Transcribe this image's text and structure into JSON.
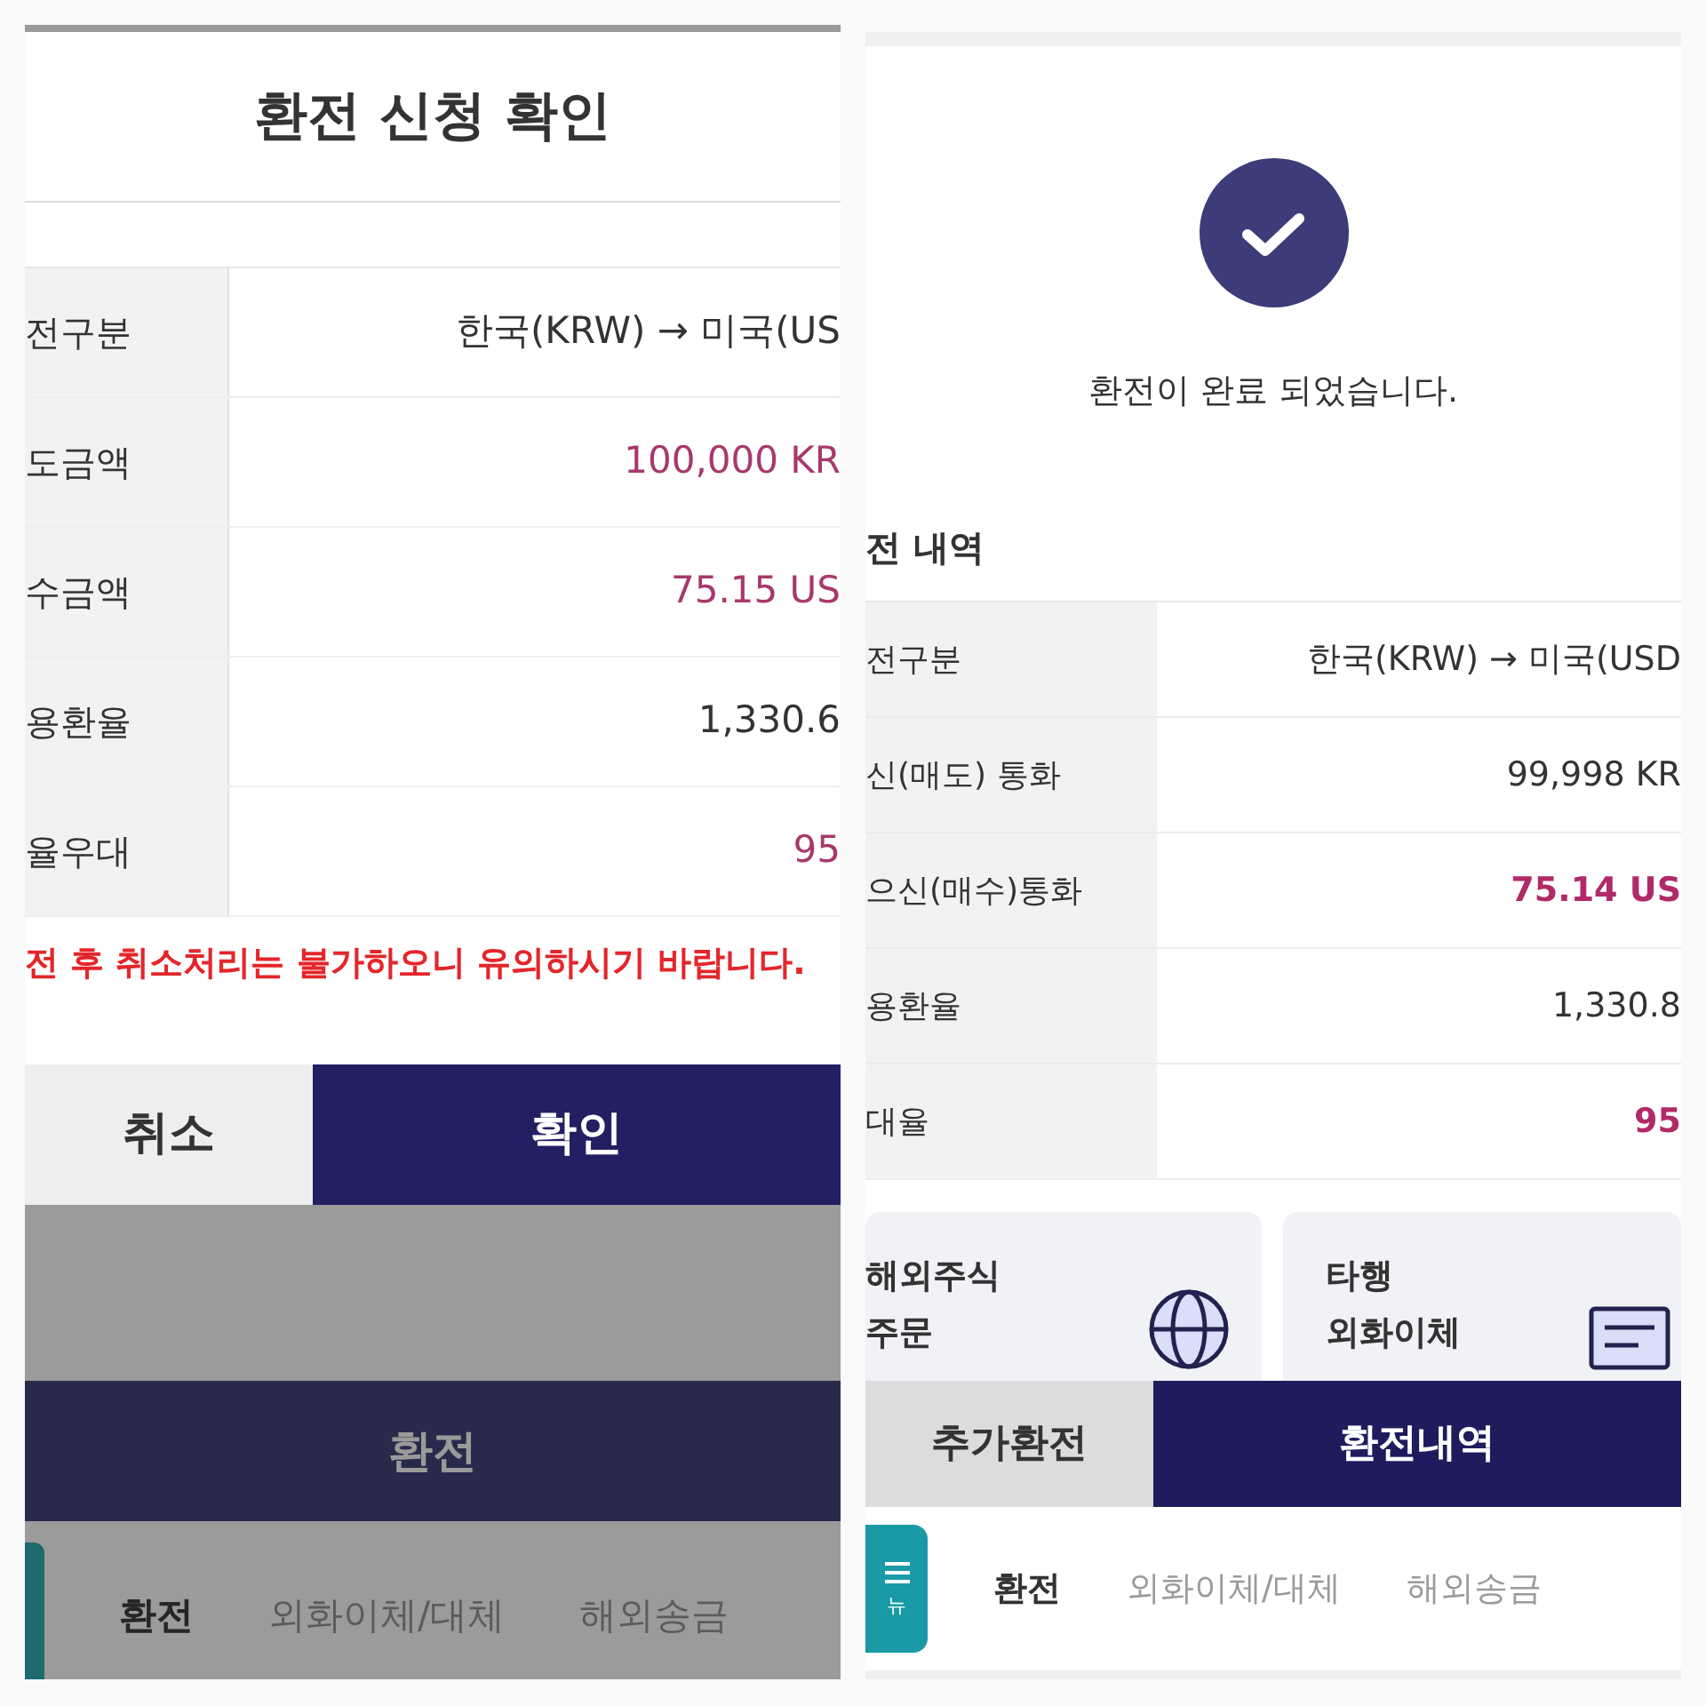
{
  "confirm_screen": {
    "title": "환전 신청 확인",
    "details": [
      {
        "label": "전구분",
        "value": "한국(KRW) → 미국(US",
        "highlight": false
      },
      {
        "label": "도금액",
        "value": "100,000 KR",
        "highlight": true
      },
      {
        "label": "수금액",
        "value": "75.15 US",
        "highlight": true
      },
      {
        "label": "용환율",
        "value": "1,330.6",
        "highlight": false
      },
      {
        "label": "율우대",
        "value": "95",
        "highlight": true
      }
    ],
    "warning": "전 후 취소처리는 불가하오니 유의하시기 바랍니다.",
    "buttons": [
      {
        "label": "취소",
        "kind": "secondary"
      },
      {
        "label": "확인",
        "kind": "primary"
      }
    ],
    "page_behind": {
      "title": "환전",
      "tabs": [
        {
          "label": "환전",
          "selected": true
        },
        {
          "label": "외화이체/대체",
          "selected": false
        },
        {
          "label": "해외송금",
          "selected": false
        }
      ]
    }
  },
  "complete_screen": {
    "message": "환전이 완료 되었습니다.",
    "section_title": "전 내역",
    "details": [
      {
        "label": "전구분",
        "value": "한국(KRW) → 미국(USD",
        "highlight": false
      },
      {
        "label": "신(매도) 통화",
        "value": "99,998 KR",
        "highlight": false
      },
      {
        "label": "으신(매수)통화",
        "value": "75.14 US",
        "highlight": true
      },
      {
        "label": "용환율",
        "value": "1,330.8",
        "highlight": false
      },
      {
        "label": "대율",
        "value": "95",
        "highlight": true
      }
    ],
    "cards": [
      {
        "lines": [
          "해외주식",
          "주문"
        ]
      },
      {
        "lines": [
          "타행",
          "외화이체"
        ]
      }
    ],
    "buttons": [
      {
        "label": "추가환전",
        "kind": "secondary"
      },
      {
        "label": "환전내역",
        "kind": "primary"
      }
    ],
    "menu_label": "뉴",
    "tabs": [
      {
        "label": "환전",
        "selected": true
      },
      {
        "label": "외화이체/대체",
        "selected": false
      },
      {
        "label": "해외송금",
        "selected": false
      }
    ]
  }
}
